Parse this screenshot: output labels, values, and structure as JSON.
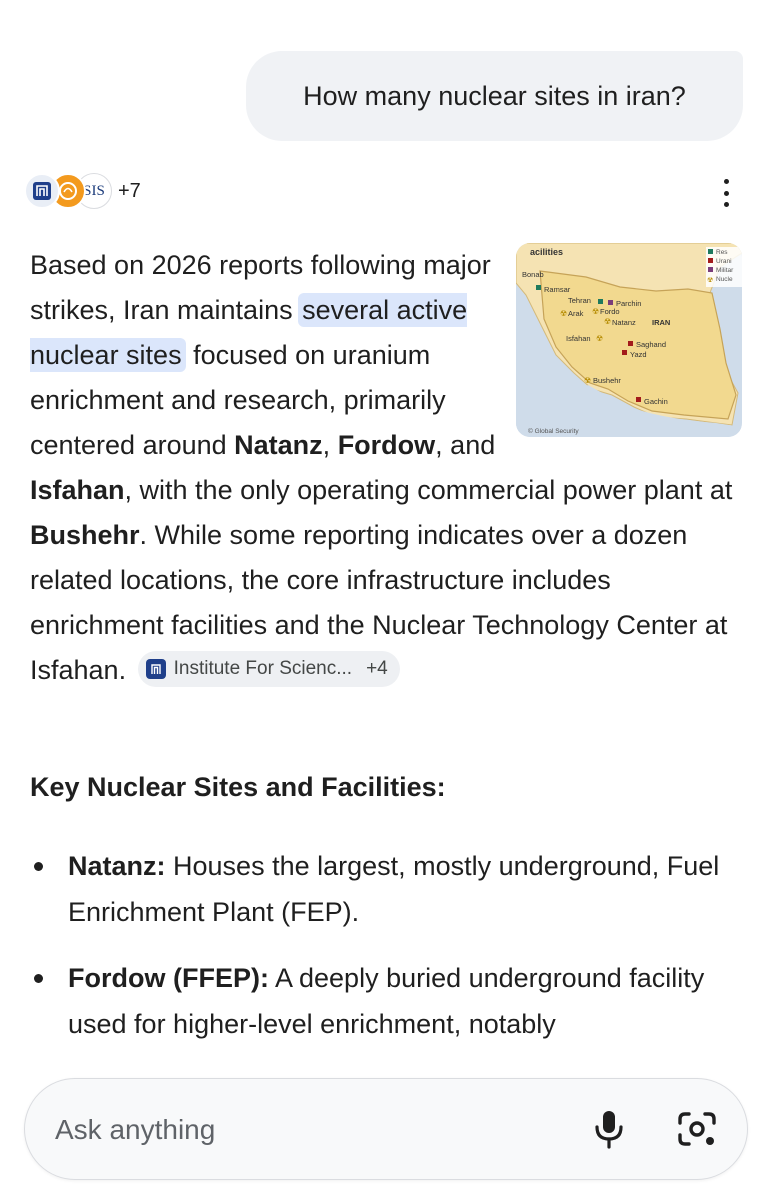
{
  "conversation": {
    "user_query": "How many nuclear sites in iran?"
  },
  "sources": {
    "more_count": "+7",
    "logo_3_text": "SIS"
  },
  "answer": {
    "intro_1": "Based on 2026 reports following major strikes, Iran maintains ",
    "highlight": "several active nuclear sites",
    "intro_2": " focused on uranium enrichment and research, primarily centered around ",
    "site_natanz": "Natanz",
    "sep_1": ", ",
    "site_fordow": "Fordow",
    "sep_2": ", and ",
    "site_isfahan": "Isfahan",
    "intro_3": ", with the only operating commercial power plant at ",
    "site_bushehr": "Bushehr",
    "intro_4": ". While some reporting indicates over a dozen related locations, the core infrastructure includes enrichment facilities and the Nuclear Technology Center at Isfahan.",
    "citation": {
      "label": "Institute For Scienc...",
      "count": "+4"
    }
  },
  "map": {
    "title": "acilities",
    "country": "IRAN",
    "credit": "© Global Security",
    "legend": [
      "Res",
      "Urani",
      "Militar",
      "Nucle"
    ],
    "places": [
      "Bonab",
      "Ramsar",
      "Tehran",
      "Parchin",
      "Arak",
      "Fordo",
      "Natanz",
      "Isfahan",
      "Saghand",
      "Yazd",
      "Bushehr",
      "Gachin"
    ],
    "colors": {
      "land": "#f5e3b3",
      "water": "#cfdcea",
      "research": "#1e7a5e",
      "uranium": "#a31b1b",
      "military": "#7a3d7a",
      "nuclear": "#b58b00"
    }
  },
  "key_sites": {
    "title": "Key Nuclear Sites and Facilities:",
    "items": [
      {
        "name": "Natanz:",
        "text": " Houses the largest, mostly underground, Fuel Enrichment Plant (FEP)."
      },
      {
        "name": "Fordow (FFEP):",
        "text": " A deeply buried underground facility used for higher-level enrichment, notably"
      }
    ]
  },
  "input": {
    "placeholder": "Ask anything"
  },
  "icons": {
    "menu": "more-vert-icon",
    "mic": "microphone-icon",
    "lens": "camera-lens-icon"
  }
}
